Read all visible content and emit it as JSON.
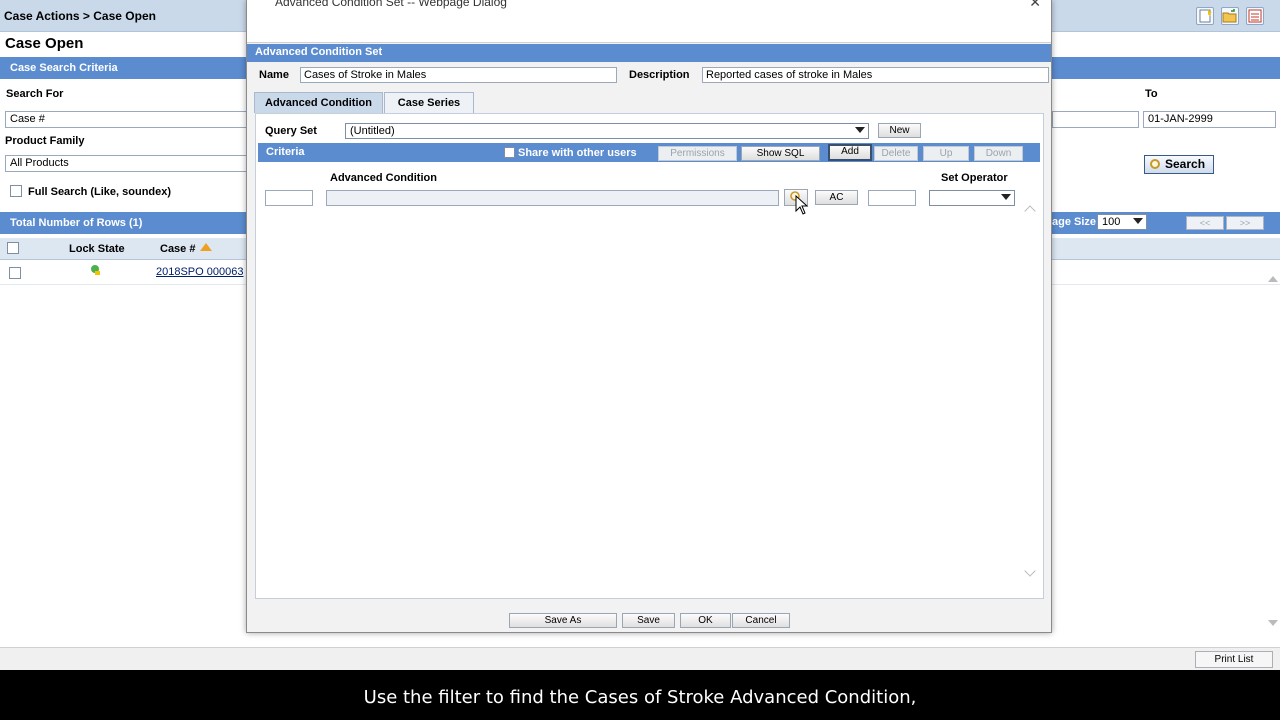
{
  "page": {
    "breadcrumb": "Case Actions > Case Open",
    "title": "Case Open",
    "criteria_header": "Case Search Criteria",
    "search_for_label": "Search For",
    "search_for_value": "Case #",
    "product_family_label": "Product Family",
    "product_family_value": "All Products",
    "full_search_label": "Full Search (Like, soundex)",
    "to_label": "To",
    "to_value": "01-JAN-2999",
    "search_button": "Search",
    "total_rows": "Total Number of Rows  (1)",
    "page_size_label": "age Size",
    "page_size_value": "100",
    "pager_prev": "<<",
    "pager_next": ">>",
    "columns": {
      "lock_state": "Lock State",
      "case_num": "Case #"
    },
    "row_case_num": "2018SPO 000063",
    "print_list": "Print List"
  },
  "dialog": {
    "window_title": "Advanced Condition Set -- Webpage Dialog",
    "header": "Advanced Condition Set",
    "name_label": "Name",
    "name_value": "Cases of Stroke in Males",
    "description_label": "Description",
    "description_value": "Reported cases of stroke in Males",
    "tabs": [
      "Advanced Condition",
      "Case Series"
    ],
    "query_set_label": "Query Set",
    "query_set_value": "(Untitled)",
    "new_button": "New",
    "criteria_label": "Criteria",
    "share_label": "Share with other users",
    "buttons": {
      "permissions": "Permissions",
      "show_sql": "Show SQL",
      "add": "Add",
      "delete": "Delete",
      "up": "Up",
      "down": "Down"
    },
    "col_advanced_condition": "Advanced Condition",
    "col_set_operator": "Set Operator",
    "ac_button": "AC",
    "footer": {
      "save_as": "Save As",
      "save": "Save",
      "ok": "OK",
      "cancel": "Cancel"
    }
  },
  "caption": "Use the filter to find the Cases of Stroke Advanced Condition,"
}
